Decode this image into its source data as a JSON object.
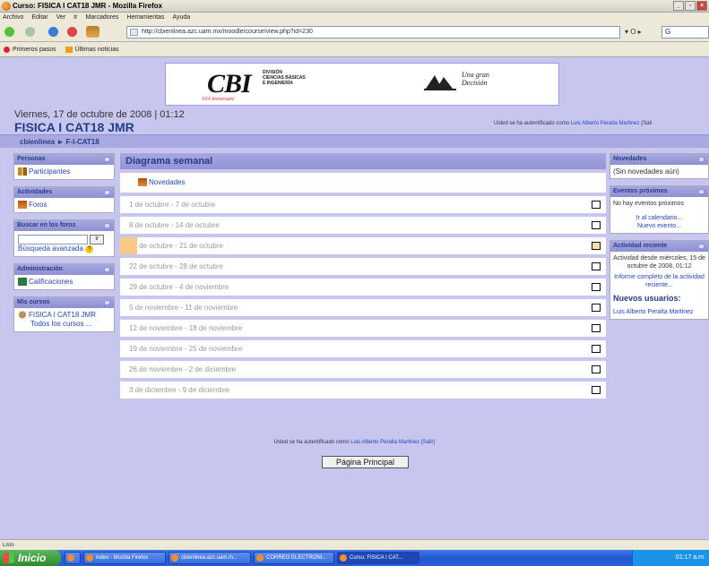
{
  "window": {
    "title": "Curso: FISICA I CAT18 JMR - Mozilla Firefox",
    "buttons": [
      "_",
      "▫",
      "×"
    ]
  },
  "menu": [
    "Archivo",
    "Editar",
    "Ver",
    "Ir",
    "Marcadores",
    "Herramientas",
    "Ayuda"
  ],
  "nav": {
    "url": "http://cbienlinea.azc.uam.mx/moodle/course/view.php?id=230",
    "go": "▾ O ▸",
    "search": "G"
  },
  "bookmarks": [
    "Primeros pasos",
    "Últimas noticias"
  ],
  "banner": {
    "logo": "CBI",
    "sub1": "DIVISIÓN",
    "sub2": "CIENCIAS BÁSICAS",
    "sub3": "E INGENIERÍA",
    "tagline": "XXX Aniversario",
    "uam_motto1": "Una gran",
    "uam_motto2": "Decisión"
  },
  "header": {
    "date": "Viernes, 17 de octubre de 2008 | 01:12",
    "course": "FISICA I CAT18 JMR",
    "logged_prefix": "Usted se ha autentificado como ",
    "user": "Luis Alberto Peralta Martinez",
    "logged_suffix": " (Sali"
  },
  "breadcrumb": {
    "home": "cbienlinea",
    "sep": "►",
    "course": "F-I-CAT18"
  },
  "left": {
    "personas": {
      "title": "Personas",
      "item": "Participantes"
    },
    "actividades": {
      "title": "Actividades",
      "item": "Foros"
    },
    "buscar": {
      "title": "Buscar en los foros",
      "go": "Ir",
      "advanced": "Búsqueda avanzada",
      "help": "?"
    },
    "admin": {
      "title": "Administración",
      "item": "Calificaciones"
    },
    "cursos": {
      "title": "Mis cursos",
      "item": "FISICA I CAT18 JMR",
      "all": "Todos los cursos ..."
    }
  },
  "main": {
    "title": "Diagrama semanal",
    "news": "Novedades",
    "weeks": [
      "1 de octubre - 7 de octubre",
      "8 de octubre - 14 de octubre",
      "15 de octubre - 21 de octubre",
      "22 de octubre - 28 de octubre",
      "29 de octubre - 4 de noviembre",
      "5 de noviembre - 11 de noviembre",
      "12 de noviembre - 18 de noviembre",
      "19 de noviembre - 25 de noviembre",
      "26 de noviembre - 2 de diciembre",
      "3 de diciembre - 9 de diciembre"
    ],
    "current_week_index": 2
  },
  "right": {
    "novedades": {
      "title": "Novedades",
      "body": "(Sin novedades aún)"
    },
    "eventos": {
      "title": "Eventos próximos",
      "body": "No hay eventos próximos",
      "cal": "Ir al calendario...",
      "new": "Nuevo evento..."
    },
    "reciente": {
      "title": "Actividad reciente",
      "body": "Actividad desde miércoles, 15 de octubre de 2008, 01:12",
      "report": "Informe completo de la actividad reciente...",
      "new_users": "Nuevos usuarios:",
      "user": "Luis Alberto Peralta Martinez"
    }
  },
  "footer": {
    "logged_prefix": "Usted se ha autentificado como ",
    "user": "Luis Alberto Peralta Martinez",
    "logout": " (Salir)",
    "home_button": "Página Principal"
  },
  "status": "Listo",
  "taskbar": {
    "start": "Inicio",
    "items": [
      "index - Mozilla Firefox",
      "cbienlinea.azc.uam.m...",
      "CORREO ELECTRONI...",
      "Curso: FISICA I CAT..."
    ],
    "clock": "01:17 a.m."
  }
}
